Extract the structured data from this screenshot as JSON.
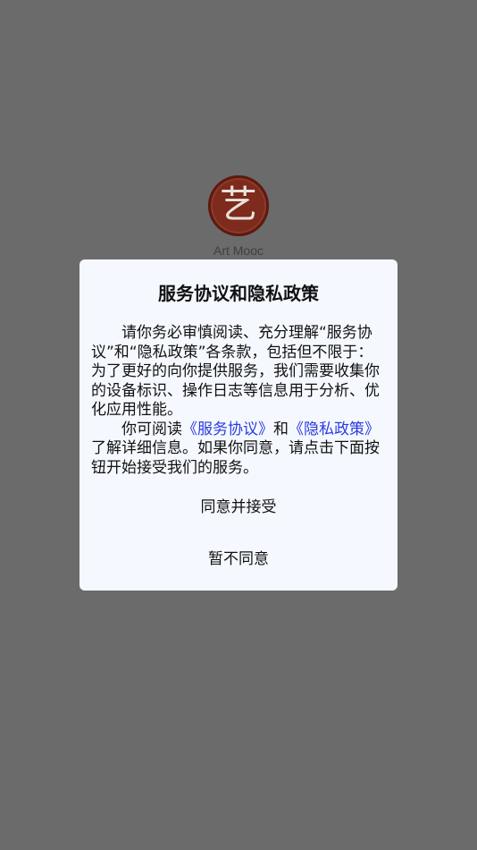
{
  "app": {
    "logo_char": "艺",
    "name": "Art Mooc"
  },
  "dialog": {
    "title": "服务协议和隐私政策",
    "para1": "请你务必审慎阅读、充分理解“服务协议”和“隐私政策”各条款，包括但不限于：为了更好的向你提供服务，我们需要收集你的设备标识、操作日志等信息用于分析、优化应用性能。",
    "para2_prefix": "你可阅读",
    "service_link": "《服务协议》",
    "and_text": "和",
    "privacy_link": "《隐私政策》",
    "para2_suffix": "了解详细信息。如果你同意，请点击下面按钮开始接受我们的服务。",
    "agree_label": "同意并接受",
    "decline_label": "暂不同意"
  }
}
